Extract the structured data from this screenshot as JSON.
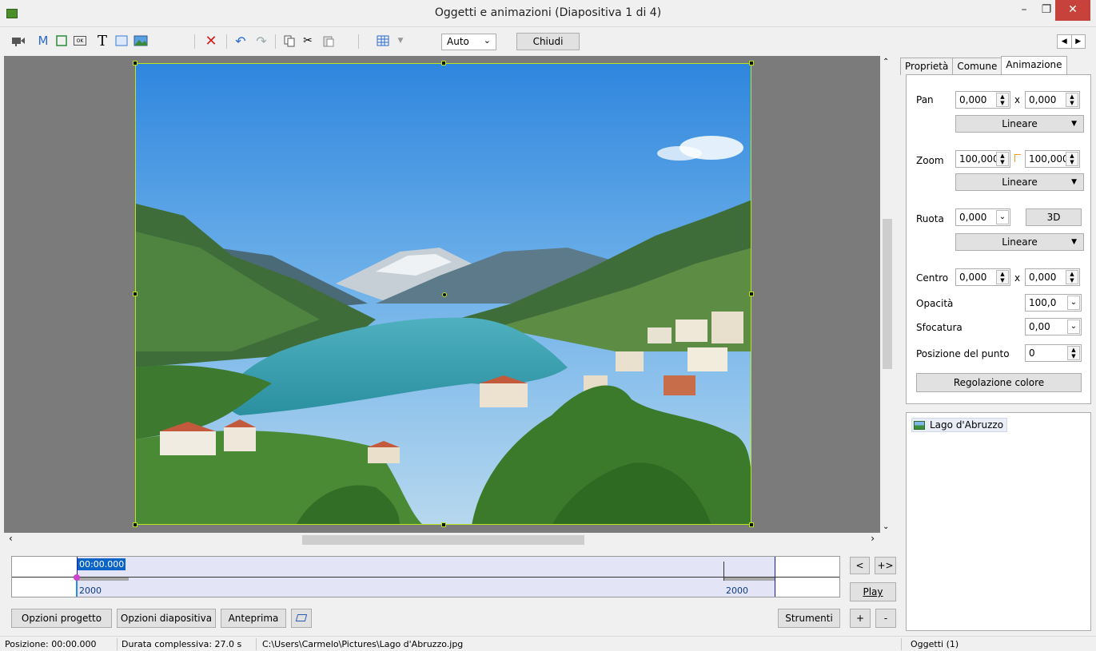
{
  "window": {
    "title": "Oggetti e animazioni  (Diapositiva 1 di 4)",
    "minimize": "–",
    "maximize": "❐",
    "close": "✕"
  },
  "toolbar": {
    "zoom_value": "Auto",
    "close_label": "Chiudi",
    "icons": [
      "camera-icon",
      "mask-icon",
      "frame-icon",
      "button-icon",
      "text-icon",
      "rectangle-icon",
      "image-icon",
      "delete-icon",
      "undo-icon",
      "redo-icon",
      "copy-icon",
      "cut-icon",
      "paste-icon",
      "grid-icon"
    ],
    "text_glyph": "T",
    "mask_glyph": "M",
    "button_glyph": "OK"
  },
  "timeline": {
    "current_time": "00:00.000",
    "start_label": "2000",
    "end_label": "2000",
    "nav_prev": "<",
    "nav_expand": "+>",
    "play_label": "Play"
  },
  "bottom_buttons": {
    "project_options": "Opzioni progetto",
    "slide_options": "Opzioni diapositiva",
    "preview": "Anteprima",
    "tools": "Strumenti",
    "add": "+",
    "remove": "-"
  },
  "properties": {
    "tabs": [
      "Proprietà",
      "Comune",
      "Animazione"
    ],
    "active_tab": "Animazione",
    "pan": {
      "label": "Pan",
      "x": "0,000",
      "y": "0,000",
      "easing": "Lineare"
    },
    "zoom": {
      "label": "Zoom",
      "x": "100,000",
      "y": "100,000",
      "easing": "Lineare"
    },
    "rotate": {
      "label": "Ruota",
      "value": "0,000",
      "btn_3d": "3D",
      "easing": "Lineare"
    },
    "center": {
      "label": "Centro",
      "x": "0,000",
      "y": "0,000"
    },
    "opacity": {
      "label": "Opacità",
      "value": "100,0"
    },
    "blur": {
      "label": "Sfocatura",
      "value": "0,00"
    },
    "point_position": {
      "label": "Posizione del punto",
      "value": "0"
    },
    "color_adjust": "Regolazione colore",
    "x_sep": "x"
  },
  "objects": {
    "items": [
      "Lago d'Abruzzo"
    ],
    "count_label": "Oggetti (1)"
  },
  "status": {
    "position": "Posizione:  00:00.000",
    "duration": "Durata complessiva:  27.0 s",
    "path": "C:\\Users\\Carmelo\\Pictures\\Lago d'Abruzzo.jpg"
  }
}
